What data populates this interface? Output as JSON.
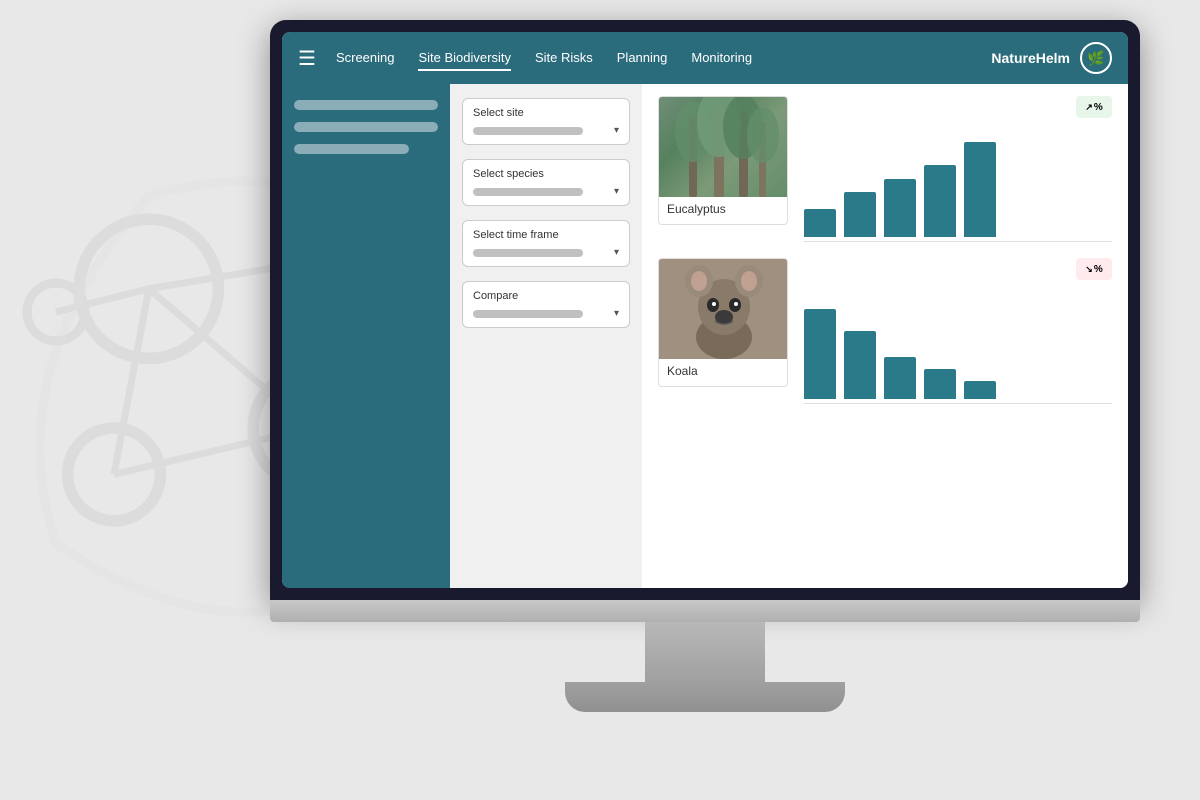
{
  "brand": {
    "name": "NatureHelm",
    "icon": "🌿"
  },
  "nav": {
    "links": [
      {
        "label": "Screening",
        "active": false
      },
      {
        "label": "Site Biodiversity",
        "active": true
      },
      {
        "label": "Site Risks",
        "active": false
      },
      {
        "label": "Planning",
        "active": false
      },
      {
        "label": "Monitoring",
        "active": false
      }
    ]
  },
  "filters": [
    {
      "label": "Select site",
      "value": ""
    },
    {
      "label": "Select species",
      "value": ""
    },
    {
      "label": "Select time frame",
      "value": ""
    },
    {
      "label": "Compare",
      "value": ""
    }
  ],
  "species": [
    {
      "name": "Eucalyptus",
      "type": "eucalyptus",
      "badge_type": "green",
      "badge_icon": "↗",
      "badge_text": "%",
      "bars": [
        28,
        45,
        55,
        68,
        90
      ]
    },
    {
      "name": "Koala",
      "type": "koala",
      "badge_type": "red",
      "badge_icon": "↘",
      "badge_text": "%",
      "bars": [
        85,
        65,
        40,
        30,
        18
      ]
    }
  ]
}
